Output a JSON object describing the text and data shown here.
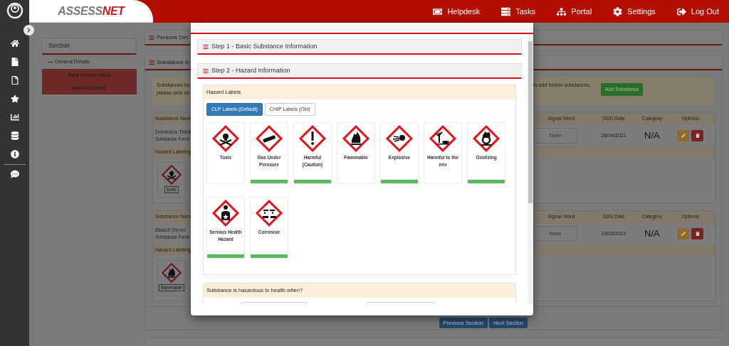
{
  "header": {
    "logo": {
      "part_1": "ASSESS",
      "part_2": "NET"
    },
    "nav": [
      {
        "label": "Helpdesk",
        "kind": "helpdesk"
      },
      {
        "label": "Tasks",
        "kind": "tasks"
      },
      {
        "label": "Portal",
        "kind": "portal"
      },
      {
        "label": "Settings",
        "kind": "settings"
      },
      {
        "label": "Log Out",
        "kind": "logout"
      }
    ]
  },
  "section_menu": {
    "title": "Section",
    "items": [
      "General Details"
    ],
    "buttons": [
      "Back to Main Menu",
      "Back to Search"
    ]
  },
  "panels": [
    {
      "title": "Persons Det"
    },
    {
      "title": "Substance In"
    }
  ],
  "notice": {
    "lines_left": [
      "Substances ha",
      "please click on"
    ],
    "text_right": "to add further substances.",
    "button": "Add Substance"
  },
  "substances": [
    {
      "column_1": "Substance Nam",
      "name": "Domestos Thick",
      "form_label": "Substance Form",
      "hazard_label": "Hazard Labeling",
      "columns": [
        "Signal Word",
        "SDS Date",
        "Category",
        "Options"
      ],
      "signal_word": "None",
      "sds_date": "28/04/2021",
      "category": "N/A",
      "pictograms": [
        {
          "label": "toxic",
          "kind": "toxic"
        }
      ]
    },
    {
      "column_1": "Substance Nam",
      "name": "Bleach Demo",
      "form_label": "Substance Form",
      "hazard_label": "Hazard Labeling",
      "columns": [
        "Signal Word",
        "SDS Date",
        "Category",
        "Options"
      ],
      "signal_word": "None",
      "sds_date": "24/03/2022",
      "category": "N/A",
      "pictograms": [
        {
          "label": "flammable",
          "kind": "flammable"
        }
      ]
    }
  ],
  "footer_buttons": [
    "Previous Section",
    "Next Section"
  ],
  "modal": {
    "steps": [
      "Step 1 - Basic Substance Information",
      "Step 2 - Hazard Information"
    ],
    "hazard_labels": {
      "title": "Hazard Labels",
      "tabs": [
        {
          "label": "CLP Labels (Default)",
          "selected": true
        },
        {
          "label": "CHIP Labels (Old)",
          "selected": false
        }
      ],
      "pictograms": [
        {
          "label": "Toxic",
          "kind": "toxic",
          "selected": false
        },
        {
          "label": "Gas Under Pressure",
          "kind": "gas",
          "selected": true
        },
        {
          "label": "Harmful (Caution)",
          "kind": "harmful",
          "selected": true
        },
        {
          "label": "Flammable",
          "kind": "flammable",
          "selected": false
        },
        {
          "label": "Explosive",
          "kind": "explosive",
          "selected": true
        },
        {
          "label": "Harmful to the env",
          "kind": "environment",
          "selected": false
        },
        {
          "label": "Oxidizing",
          "kind": "oxidizing",
          "selected": true
        },
        {
          "label": "Serious Health Hazard",
          "kind": "health",
          "selected": true
        },
        {
          "label": "Corrosive",
          "kind": "corrosive",
          "selected": true
        }
      ]
    },
    "health_question": {
      "title": "Substance is hazardous to health when?"
    }
  }
}
